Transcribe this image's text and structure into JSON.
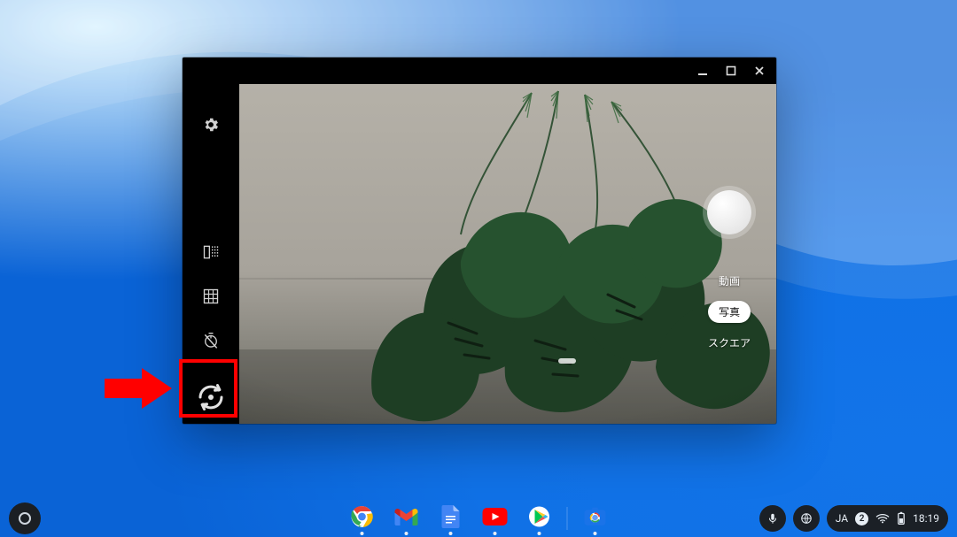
{
  "modes": {
    "video": "動画",
    "photo": "写真",
    "square": "スクエア"
  },
  "status": {
    "ime": "JA",
    "notif_count": "2",
    "time": "18:19"
  },
  "icons": {
    "settings": "settings-icon",
    "mirror": "mirror-icon",
    "grid": "grid-icon",
    "timer": "timer-off-icon",
    "switch": "switch-camera-icon"
  }
}
